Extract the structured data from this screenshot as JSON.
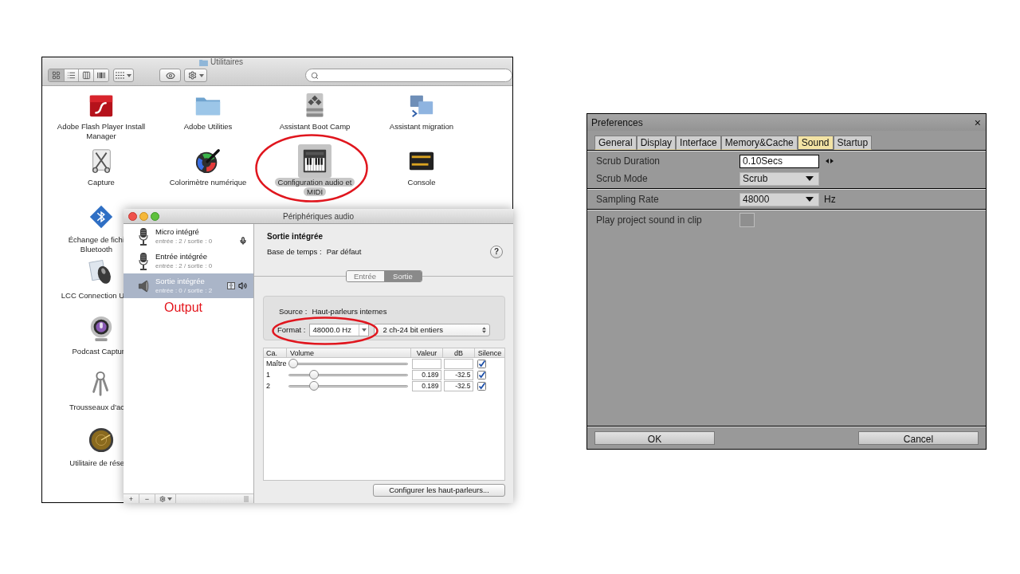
{
  "finder": {
    "title": "Utilitaires",
    "view_buttons": [
      {
        "kind": "icons",
        "selected": true
      },
      {
        "kind": "list",
        "selected": false
      },
      {
        "kind": "columns",
        "selected": false
      },
      {
        "kind": "coverflow",
        "selected": false
      }
    ],
    "items": [
      {
        "kind": "flash",
        "lines": [
          "Adobe Flash Player Install",
          "Manager"
        ],
        "selected": false
      },
      {
        "kind": "folder",
        "lines": [
          "Adobe Utilities"
        ],
        "selected": false
      },
      {
        "kind": "bootcamp",
        "lines": [
          "Assistant Boot Camp"
        ],
        "selected": false
      },
      {
        "kind": "migration",
        "lines": [
          "Assistant migration"
        ],
        "selected": false
      },
      {
        "kind": "capture",
        "lines": [
          "Capture"
        ],
        "selected": false
      },
      {
        "kind": "colorimeter",
        "lines": [
          "Colorimètre numérique"
        ],
        "selected": false
      },
      {
        "kind": "piano",
        "lines": [
          "Configuration audio et",
          "MIDI"
        ],
        "selected": true
      },
      {
        "kind": "console",
        "lines": [
          "Console"
        ],
        "selected": false
      }
    ],
    "partly_covered_items": [
      {
        "kind": "bluetooth",
        "lines": [
          "Échange de fichi",
          "Bluetooth"
        ]
      },
      {
        "kind": "mouse",
        "lines": [
          "LCC Connection U"
        ]
      },
      {
        "kind": "podcast",
        "lines": [
          "Podcast Captur"
        ]
      },
      {
        "kind": "keychain",
        "lines": [
          "Trousseaux d'ac"
        ]
      },
      {
        "kind": "radar",
        "lines": [
          "Utilitaire de rése"
        ]
      }
    ]
  },
  "audio_window": {
    "title": "Périphériques audio",
    "devices": [
      {
        "kind": "microphone",
        "name": "Micro intégré",
        "channels": "entrée : 2 / sortie : 0",
        "selected": false,
        "default_input": true,
        "default_output": false,
        "system_output": false
      },
      {
        "kind": "microphone",
        "name": "Entrée intégrée",
        "channels": "entrée : 2 / sortie : 0",
        "selected": false,
        "default_input": false,
        "default_output": false,
        "system_output": false
      },
      {
        "kind": "speaker",
        "name": "Sortie intégrée",
        "channels": "entrée : 0 / sortie : 2",
        "selected": true,
        "default_input": false,
        "default_output": true,
        "system_output": true
      }
    ],
    "annotation": "Output",
    "list_buttons": [
      "+",
      "−"
    ],
    "detail": {
      "device": "Sortie intégrée",
      "clock": {
        "label": "Base de temps :",
        "value": "Par défaut"
      },
      "help": "?",
      "tabs": [
        {
          "label": "Entrée",
          "selected": false
        },
        {
          "label": "Sortie",
          "selected": true
        }
      ],
      "source": {
        "label": "Source :",
        "value": "Haut-parleurs internes"
      },
      "format": {
        "label": "Format :",
        "rate": "48000.0 Hz",
        "depth": "2 ch-24 bit entiers"
      },
      "columns": [
        "Ca.",
        "Volume",
        "Valeur",
        "dB",
        "Silence"
      ],
      "channels": [
        {
          "name": "Maître",
          "level": 0,
          "muted": true
        },
        {
          "name": "1",
          "level": 0.19,
          "value": "0.189",
          "db": "-32.5",
          "muted": true
        },
        {
          "name": "2",
          "level": 0.19,
          "value": "0.189",
          "db": "-32.5",
          "muted": true
        }
      ],
      "button": "Configurer les haut-parleurs..."
    }
  },
  "preferences": {
    "title": "Preferences",
    "close": "×",
    "tabs": [
      {
        "label": "General",
        "selected": false
      },
      {
        "label": "Display",
        "selected": false
      },
      {
        "label": "Interface",
        "selected": false
      },
      {
        "label": "Memory&Cache",
        "selected": false
      },
      {
        "label": "Sound",
        "selected": true
      },
      {
        "label": "Startup",
        "selected": false
      }
    ],
    "sections": [
      {
        "rows": [
          {
            "kind": "spin",
            "label": "Scrub Duration",
            "value": "0.10Secs"
          },
          {
            "kind": "dropdown",
            "label": "Scrub Mode",
            "value": "Scrub"
          }
        ]
      },
      {
        "rows": [
          {
            "kind": "dropdown",
            "label": "Sampling Rate",
            "value": "48000",
            "unit": "Hz"
          }
        ]
      },
      {
        "rows": [
          {
            "kind": "checkbox",
            "label": "Play project sound in clip",
            "checked": false
          }
        ]
      }
    ],
    "buttons": [
      "OK",
      "Cancel"
    ]
  }
}
